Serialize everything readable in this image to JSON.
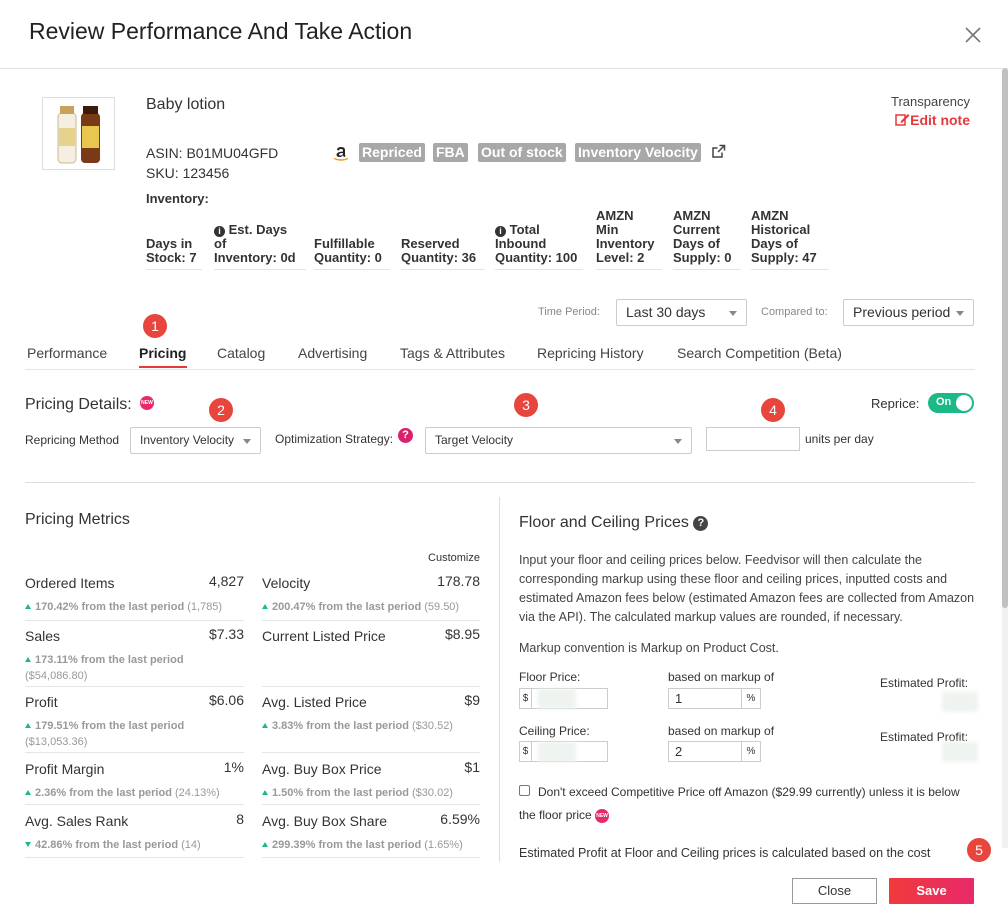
{
  "modal": {
    "title": "Review Performance And Take Action"
  },
  "product": {
    "name": "Baby lotion",
    "asin": "ASIN: B01MU04GFD",
    "sku": "SKU: 123456",
    "tags": [
      "Repriced",
      "FBA",
      "Out of stock",
      "Inventory Velocity"
    ],
    "transparency": "Transparency",
    "edit_note": "Edit note"
  },
  "inventory": {
    "label": "Inventory:",
    "cells": [
      "Days in\nStock: 7",
      "of\nInventory: 0d",
      "Fulfillable\nQuantity: 0",
      "Reserved\nQuantity: 36",
      "Inbound\nQuantity: 100",
      "AMZN\nMin\nInventory\nLevel: 2",
      "AMZN\nCurrent\nDays of\nSupply: 0",
      "AMZN\nHistorical\nDays of\nSupply: 47"
    ],
    "est_days_head": "Est. Days",
    "total_head": "Total"
  },
  "period": {
    "time_label": "Time Period:",
    "time_value": "Last 30 days",
    "compare_label": "Compared to:",
    "compare_value": "Previous period"
  },
  "tabs": [
    "Performance",
    "Pricing",
    "Catalog",
    "Advertising",
    "Tags & Attributes",
    "Repricing History",
    "Search Competition (Beta)"
  ],
  "pricing_details": {
    "title": "Pricing Details:",
    "new_badge": "NEW",
    "reprice_label": "Reprice:",
    "reprice_state": "On",
    "method_label": "Repricing Method",
    "method_value": "Inventory Velocity",
    "strategy_label": "Optimization Strategy:",
    "strategy_value": "Target Velocity",
    "units_value": "",
    "units_label": "units per day",
    "steps": [
      "1",
      "2",
      "3",
      "4",
      "5"
    ]
  },
  "metrics": {
    "title": "Pricing Metrics",
    "customize": "Customize",
    "left": [
      {
        "label": "Ordered Items",
        "value": "4,827",
        "change": "170.42% from the last period",
        "prev": "(1,785)",
        "dir": "up"
      },
      {
        "label": "Sales",
        "value": "$7.33",
        "change": "173.11% from the last period",
        "prev": "($54,086.80)",
        "dir": "up"
      },
      {
        "label": "Profit",
        "value": "$6.06",
        "change": "179.51% from the last period",
        "prev": "($13,053.36)",
        "dir": "up"
      },
      {
        "label": "Profit Margin",
        "value": "1%",
        "change": "2.36% from the last period",
        "prev": "(24.13%)",
        "dir": "up"
      },
      {
        "label": "Avg. Sales Rank",
        "value": "8",
        "change": "42.86% from the last period",
        "prev": "(14)",
        "dir": "down"
      }
    ],
    "right": [
      {
        "label": "Velocity",
        "value": "178.78",
        "change": "200.47% from the last period",
        "prev": "(59.50)",
        "dir": "up"
      },
      {
        "label": "Current Listed Price",
        "value": "$8.95",
        "change": "",
        "prev": "",
        "dir": ""
      },
      {
        "label": "Avg. Listed Price",
        "value": "$9",
        "change": "3.83% from the last period",
        "prev": "($30.52)",
        "dir": "up"
      },
      {
        "label": "Avg. Buy Box Price",
        "value": "$1",
        "change": "1.50% from the last period",
        "prev": "($30.02)",
        "dir": "up"
      },
      {
        "label": "Avg. Buy Box Share",
        "value": "6.59%",
        "change": "299.39% from the last period",
        "prev": "(1.65%)",
        "dir": "up"
      }
    ]
  },
  "floor_ceiling": {
    "title": "Floor and Ceiling Prices",
    "description": "Input your floor and ceiling prices below. Feedvisor will then calculate the corresponding markup using these floor and ceiling prices, inputted costs and estimated Amazon fees below (estimated Amazon fees are collected from Amazon via the API). The calculated markup values are rounded, if necessary.",
    "convention": "Markup convention is Markup on Product Cost.",
    "floor_label": "Floor Price:",
    "ceiling_label": "Ceiling Price:",
    "markup_label": "based on markup of",
    "floor_markup": "1",
    "ceiling_markup": "2",
    "currency": "$",
    "percent": "%",
    "est_profit": "Estimated Profit:",
    "checkbox_text": "Don't exceed Competitive Price off Amazon ($29.99 currently) unless it is below the floor price",
    "bottom_text": "Estimated Profit at Floor and Ceiling prices is calculated based on the cost"
  },
  "footer": {
    "close": "Close",
    "save": "Save"
  }
}
